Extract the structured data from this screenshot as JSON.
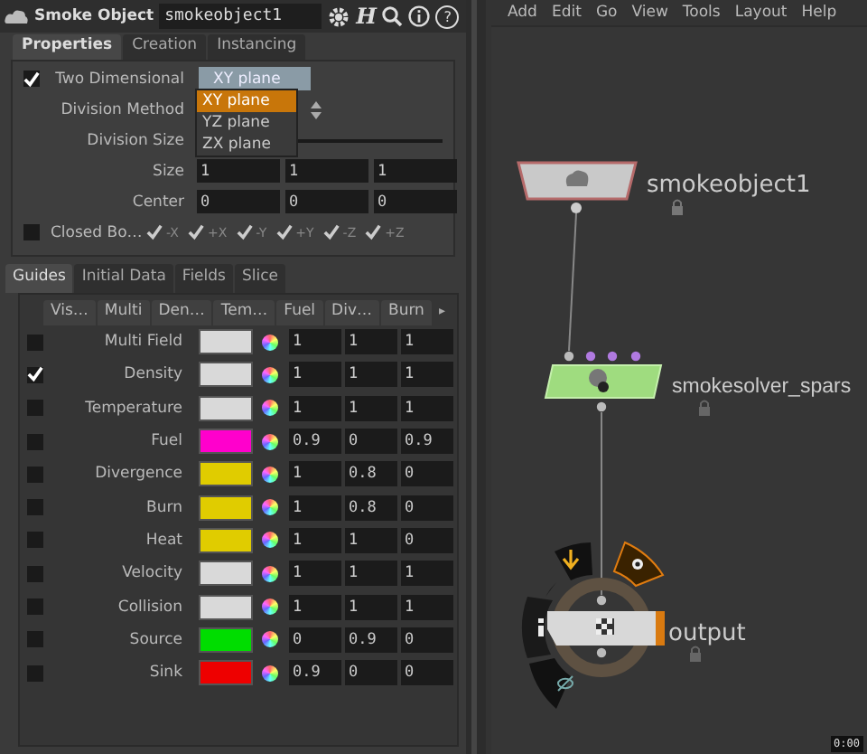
{
  "header": {
    "type_label": "Smoke Object",
    "node_name": "smokeobject1",
    "logo_glyph": "H",
    "help_glyph": "?"
  },
  "tabs": [
    {
      "label": "Properties",
      "selected": true
    },
    {
      "label": "Creation",
      "selected": false
    },
    {
      "label": "Instancing",
      "selected": false
    }
  ],
  "params": [
    {
      "kind": "toggle-menu",
      "label": "Two Dimensional",
      "checked": true,
      "value": "XY plane"
    },
    {
      "kind": "menu",
      "label": "Division Method"
    },
    {
      "kind": "slider",
      "label": "Division Size"
    },
    {
      "kind": "vector",
      "label": "Size",
      "values": [
        "1",
        "1",
        "1"
      ]
    },
    {
      "kind": "vector",
      "label": "Center",
      "values": [
        "0",
        "0",
        "0"
      ]
    }
  ],
  "closed_boundaries": {
    "label": "Closed Bo…",
    "checked": false,
    "axes": [
      {
        "label": "-X",
        "checked": true
      },
      {
        "label": "+X",
        "checked": true
      },
      {
        "label": "-Y",
        "checked": true
      },
      {
        "label": "+Y",
        "checked": true
      },
      {
        "label": "-Z",
        "checked": true
      },
      {
        "label": "+Z",
        "checked": true
      }
    ]
  },
  "dropdown_menu": [
    {
      "label": "XY plane",
      "selected": true
    },
    {
      "label": "YZ plane",
      "selected": false
    },
    {
      "label": "ZX plane",
      "selected": false
    }
  ],
  "guide_tabs": [
    {
      "label": "Guides",
      "selected": true
    },
    {
      "label": "Initial Data",
      "selected": false
    },
    {
      "label": "Fields",
      "selected": false
    },
    {
      "label": "Slice",
      "selected": false
    }
  ],
  "columns": [
    "Vis…",
    "Multi",
    "Den…",
    "Tem…",
    "Fuel",
    "Div…",
    "Burn"
  ],
  "columns_more": "▸",
  "fields": [
    {
      "label": "Multi Field",
      "checked": false,
      "color": "#d9d9d9",
      "values": [
        "1",
        "1",
        "1"
      ]
    },
    {
      "label": "Density",
      "checked": true,
      "color": "#d9d9d9",
      "values": [
        "1",
        "1",
        "1"
      ]
    },
    {
      "label": "Temperature",
      "checked": false,
      "color": "#d9d9d9",
      "values": [
        "1",
        "1",
        "1"
      ]
    },
    {
      "label": "Fuel",
      "checked": false,
      "color": "#ff00cc",
      "values": [
        "0.9",
        "0",
        "0.9"
      ]
    },
    {
      "label": "Divergence",
      "checked": false,
      "color": "#e0cc00",
      "values": [
        "1",
        "0.8",
        "0"
      ]
    },
    {
      "label": "Burn",
      "checked": false,
      "color": "#e0cc00",
      "values": [
        "1",
        "0.8",
        "0"
      ]
    },
    {
      "label": "Heat",
      "checked": false,
      "color": "#e0cc00",
      "values": [
        "1",
        "1",
        "0"
      ]
    },
    {
      "label": "Velocity",
      "checked": false,
      "color": "#d9d9d9",
      "values": [
        "1",
        "1",
        "1"
      ]
    },
    {
      "label": "Collision",
      "checked": false,
      "color": "#d9d9d9",
      "values": [
        "1",
        "1",
        "1"
      ]
    },
    {
      "label": "Source",
      "checked": false,
      "color": "#00dd00",
      "values": [
        "0",
        "0.9",
        "0"
      ]
    },
    {
      "label": "Sink",
      "checked": false,
      "color": "#ee0000",
      "values": [
        "0.9",
        "0",
        "0"
      ]
    }
  ],
  "menubar": [
    "Add",
    "Edit",
    "Go",
    "View",
    "Tools",
    "Layout",
    "Help"
  ],
  "nodes": [
    {
      "kind": "object",
      "name": "smokeobject1"
    },
    {
      "kind": "solver",
      "name": "smokesolver_spars"
    },
    {
      "kind": "output",
      "name": "output"
    }
  ],
  "timestamp": "0:00"
}
